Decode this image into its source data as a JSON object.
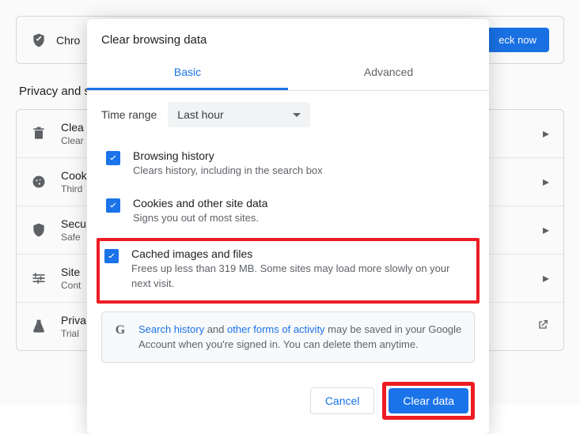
{
  "background": {
    "banner_text": "Chro",
    "banner_button": "eck now",
    "section_title": "Privacy and s",
    "rows": [
      {
        "title": "Clea",
        "sub": "Clear"
      },
      {
        "title": "Cook",
        "sub": "Third"
      },
      {
        "title": "Secu",
        "sub": "Safe"
      },
      {
        "title": "Site",
        "sub": "Cont"
      },
      {
        "title": "Priva",
        "sub": "Trial"
      }
    ]
  },
  "dialog": {
    "title": "Clear browsing data",
    "tabs": {
      "basic": "Basic",
      "advanced": "Advanced",
      "active": "basic"
    },
    "time_label": "Time range",
    "time_value": "Last hour",
    "items": [
      {
        "checked": true,
        "title": "Browsing history",
        "desc": "Clears history, including in the search box",
        "highlighted": false
      },
      {
        "checked": true,
        "title": "Cookies and other site data",
        "desc": "Signs you out of most sites.",
        "highlighted": false
      },
      {
        "checked": true,
        "title": "Cached images and files",
        "desc": "Frees up less than 319 MB. Some sites may load more slowly on your next visit.",
        "highlighted": true
      }
    ],
    "info": {
      "link1": "Search history",
      "mid1": " and ",
      "link2": "other forms of activity",
      "rest": " may be saved in your Google Account when you're signed in. You can delete them anytime."
    },
    "cancel": "Cancel",
    "confirm": "Clear data"
  }
}
